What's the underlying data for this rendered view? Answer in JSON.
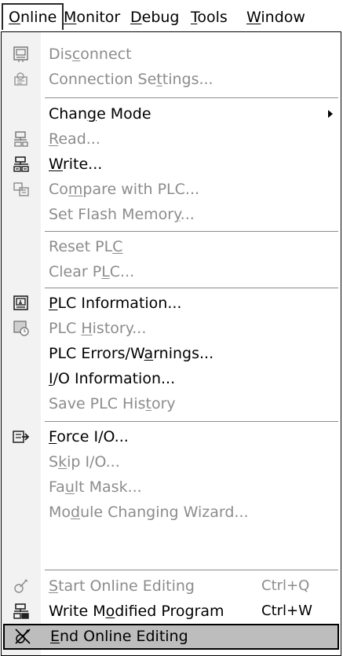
{
  "menubar": [
    {
      "pre": "",
      "key": "O",
      "post": "nline",
      "active": true
    },
    {
      "pre": "",
      "key": "M",
      "post": "onitor",
      "active": false
    },
    {
      "pre": "",
      "key": "D",
      "post": "ebug",
      "active": false
    },
    {
      "pre": "",
      "key": "T",
      "post": "ools",
      "active": false
    },
    {
      "pre": "",
      "key": "W",
      "post": "indow",
      "active": false
    }
  ],
  "menu": {
    "items": [
      {
        "id": "disconnect",
        "pre": "Dis",
        "key": "c",
        "post": "onnect",
        "disabled": true,
        "icon": "disconnect-icon"
      },
      {
        "id": "connection-settings",
        "pre": "Connection Se",
        "key": "t",
        "post": "tings...",
        "disabled": true,
        "icon": "connection-settings-icon"
      },
      {
        "id": "change-mode",
        "pre": "Chan",
        "key": "g",
        "post": "e Mode",
        "disabled": false,
        "submenu": true
      },
      {
        "id": "read",
        "pre": "",
        "key": "R",
        "post": "ead...",
        "disabled": true,
        "icon": "read-from-plc-icon"
      },
      {
        "id": "write",
        "pre": "",
        "key": "W",
        "post": "rite...",
        "disabled": false,
        "icon": "write-to-plc-icon"
      },
      {
        "id": "compare-with-plc",
        "pre": "Co",
        "key": "m",
        "post": "pare with PLC...",
        "disabled": true,
        "icon": "compare-icon"
      },
      {
        "id": "set-flash-memory",
        "pre": "Set Flash Memor",
        "key": "y",
        "post": "...",
        "disabled": true
      },
      {
        "id": "reset-plc",
        "pre": "Reset PL",
        "key": "C",
        "post": "",
        "disabled": true
      },
      {
        "id": "clear-plc",
        "pre": "Clear P",
        "key": "L",
        "post": "C...",
        "disabled": true
      },
      {
        "id": "plc-information",
        "pre": "",
        "key": "P",
        "post": "LC Information...",
        "disabled": false,
        "icon": "plc-information-icon"
      },
      {
        "id": "plc-history",
        "pre": "PLC ",
        "key": "H",
        "post": "istory...",
        "disabled": true,
        "icon": "plc-history-icon"
      },
      {
        "id": "plc-errors-warnings",
        "pre": "PLC Errors/W",
        "key": "a",
        "post": "rnings...",
        "disabled": false
      },
      {
        "id": "io-information",
        "pre": "",
        "key": "I",
        "post": "/O Information...",
        "disabled": false
      },
      {
        "id": "save-plc-history",
        "pre": "Save PLC His",
        "key": "t",
        "post": "ory",
        "disabled": true
      },
      {
        "id": "force-io",
        "pre": "",
        "key": "F",
        "post": "orce I/O...",
        "disabled": false,
        "icon": "force-io-icon"
      },
      {
        "id": "skip-io",
        "pre": "S",
        "key": "k",
        "post": "ip I/O...",
        "disabled": true
      },
      {
        "id": "fault-mask",
        "pre": "Fa",
        "key": "u",
        "post": "lt Mask...",
        "disabled": true
      },
      {
        "id": "module-changing-wizard",
        "pre": "Mo",
        "key": "d",
        "post": "ule Changing Wizard...",
        "disabled": true
      },
      {
        "id": "start-online-editing",
        "pre": "",
        "key": "S",
        "post": "tart Online Editing",
        "disabled": true,
        "shortcut": "Ctrl+Q",
        "icon": "start-online-editing-icon"
      },
      {
        "id": "write-modified-program",
        "pre": "Write M",
        "key": "o",
        "post": "dified Program",
        "disabled": false,
        "shortcut": "Ctrl+W",
        "icon": "write-modified-program-icon"
      },
      {
        "id": "end-online-editing",
        "pre": "",
        "key": "E",
        "post": "nd Online Editing",
        "disabled": false,
        "highlighted": true,
        "icon": "end-online-editing-icon"
      }
    ]
  }
}
